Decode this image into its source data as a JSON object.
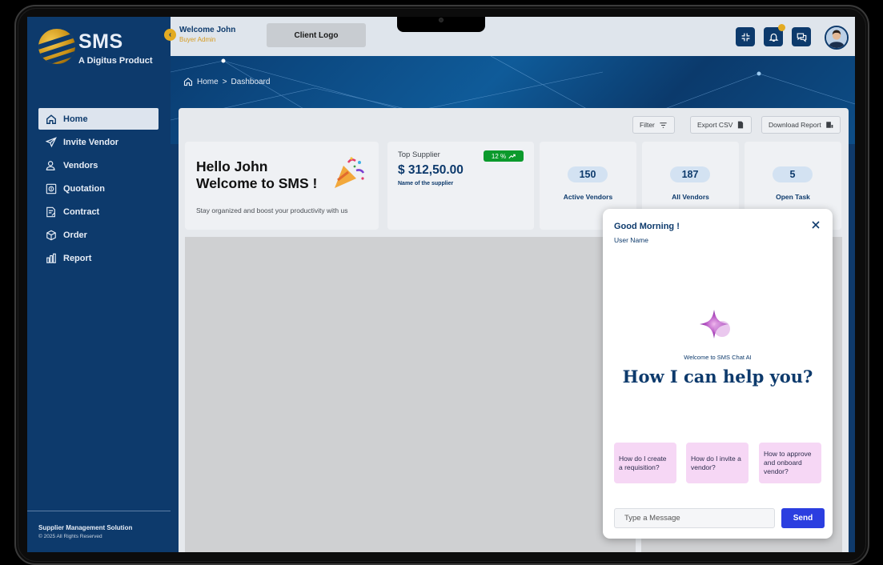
{
  "app": {
    "name": "SMS",
    "tagline": "A Digitus Product"
  },
  "sidebar": {
    "items": [
      {
        "label": "Home",
        "icon": "home-icon"
      },
      {
        "label": "Invite Vendor",
        "icon": "send-icon"
      },
      {
        "label": "Vendors",
        "icon": "users-icon"
      },
      {
        "label": "Quotation",
        "icon": "quotation-icon"
      },
      {
        "label": "Contract",
        "icon": "contract-icon"
      },
      {
        "label": "Order",
        "icon": "box-icon"
      },
      {
        "label": "Report",
        "icon": "bar-chart-icon"
      }
    ],
    "footer_title": "Supplier Management Solution",
    "footer_copyright": "© 2025 All Rights Reserved"
  },
  "header": {
    "welcome": "Welcome John",
    "role": "Buyer Admin",
    "client_logo": "Client Logo",
    "notification_color": "#e3ab22"
  },
  "breadcrumb": {
    "home": "Home",
    "separator": ">",
    "current": "Dashboard"
  },
  "toolbar": {
    "filter": "Filter",
    "export": "Export CSV",
    "download": "Download Report"
  },
  "greeting_card": {
    "line1": "Hello John",
    "line2": "Welcome to SMS !",
    "subtitle": "Stay organized and boost your productivity with us"
  },
  "top_supplier": {
    "label": "Top Supplier",
    "value": "$ 312,50.00",
    "name": "Name of the supplier",
    "badge": "12 %"
  },
  "stats": [
    {
      "value": "150",
      "label": "Active Vendors"
    },
    {
      "value": "187",
      "label": "All Vendors"
    },
    {
      "value": "5",
      "label": "Open Task"
    }
  ],
  "chat": {
    "greeting": "Good Morning !",
    "user": "User Name",
    "welcome": "Welcome to SMS Chat AI",
    "headline": "How I can help you?",
    "suggestions": [
      "How do I create a requisition?",
      "How do I invite a vendor?",
      "How to approve and onboard vendor?"
    ],
    "input_placeholder": "Type a Message",
    "send": "Send"
  },
  "colors": {
    "primary": "#0d3a6c",
    "accent": "#e3ab22",
    "success": "#0b9a2c",
    "send": "#2b3ee0",
    "suggestion_bg": "#f6d7f5"
  }
}
